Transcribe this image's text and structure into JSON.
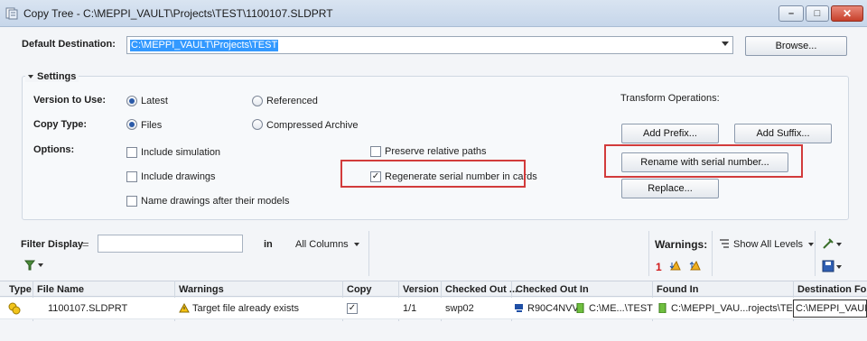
{
  "window": {
    "title": "Copy Tree - C:\\MEPPI_VAULT\\Projects\\TEST\\1100107.SLDPRT",
    "minimize_glyph": "–",
    "maximize_glyph": "□",
    "close_glyph": "✕"
  },
  "destination": {
    "label": "Default Destination:",
    "value": "C:\\MEPPI_VAULT\\Projects\\TEST",
    "browse_label": "Browse..."
  },
  "settings": {
    "title": "Settings",
    "version_label": "Version to Use:",
    "version_options": [
      "Latest",
      "Referenced"
    ],
    "version_selected": "Latest",
    "copy_type_label": "Copy Type:",
    "copy_type_options": [
      "Files",
      "Compressed Archive"
    ],
    "copy_type_selected": "Files",
    "options_label": "Options:",
    "options": {
      "include_simulation": {
        "label": "Include simulation",
        "checked": false
      },
      "include_drawings": {
        "label": "Include drawings",
        "checked": false
      },
      "name_drawings": {
        "label": "Name drawings after their models",
        "checked": false
      },
      "preserve_paths": {
        "label": "Preserve relative paths",
        "checked": false
      },
      "regenerate_serial": {
        "label": "Regenerate serial number in cards",
        "checked": true
      }
    },
    "transform": {
      "title": "Transform Operations:",
      "add_prefix": "Add Prefix...",
      "add_suffix": "Add Suffix...",
      "rename_serial": "Rename with serial number...",
      "replace": "Replace..."
    }
  },
  "filter": {
    "label": "Filter Display",
    "operator": "=",
    "value": "",
    "in_label": "in",
    "columns": "All Columns"
  },
  "warnings": {
    "label": "Warnings:",
    "count": "1",
    "show_levels": "Show All Levels"
  },
  "grid": {
    "columns": [
      "Type",
      "File Name",
      "Warnings",
      "Copy",
      "Version",
      "Checked Out ...",
      "Checked Out In",
      "Found In",
      "Destination Folder"
    ],
    "rows": [
      {
        "file_name": "1100107.SLDPRT",
        "warning": "Target file already exists",
        "copy": true,
        "version": "1/1",
        "checked_out_by": "swp02",
        "checked_out_computer": "R90C4NVV",
        "checked_out_in": "C:\\ME...\\TEST",
        "found_in": "C:\\MEPPI_VAU...rojects\\TEST",
        "destination": "C:\\MEPPI_VAULT"
      }
    ]
  },
  "colors": {
    "highlight_box": "#d23b3b",
    "selection": "#3399ff"
  }
}
